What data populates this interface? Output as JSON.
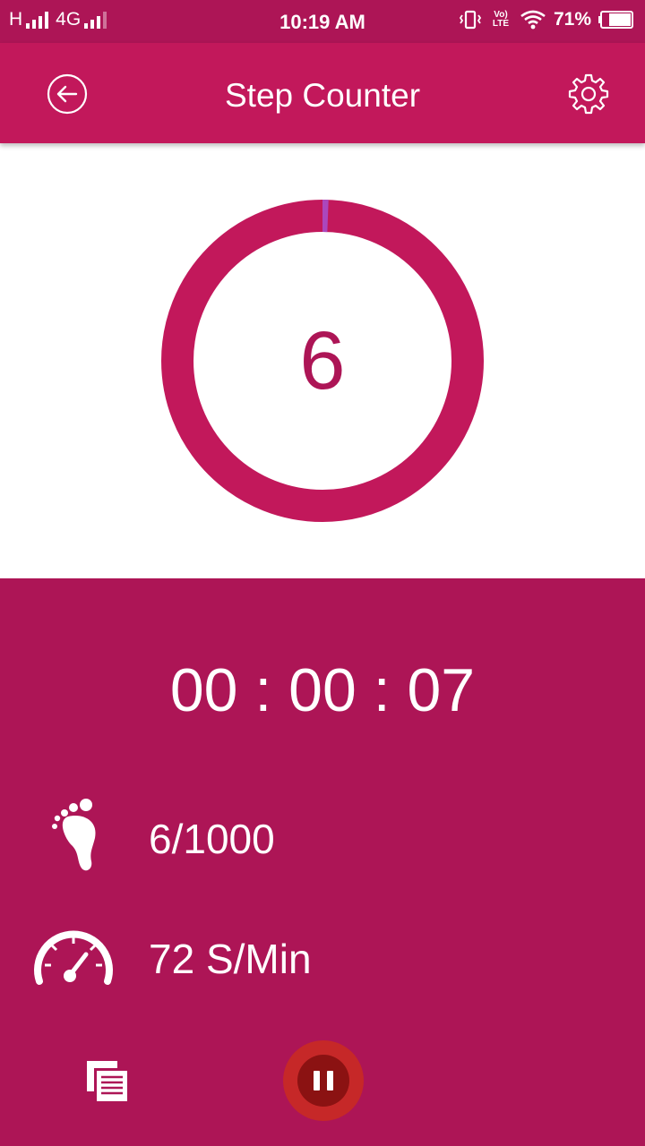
{
  "status_bar": {
    "network_h": "H",
    "network_4g": "4G",
    "time": "10:19 AM",
    "volte": "Vo) LTE",
    "battery": "71%"
  },
  "app_bar": {
    "title": "Step Counter",
    "back_icon": "back-arrow-circle-icon",
    "settings_icon": "gear-icon"
  },
  "progress": {
    "step_count": "6",
    "steps": 6,
    "goal": 1000,
    "track_color": "#c2185b",
    "progress_color": "#ab47bc"
  },
  "stats": {
    "timer": "00 : 00 : 07",
    "steps_goal": "6/1000",
    "pace": "72 S/Min",
    "steps_icon": "footprint-icon",
    "pace_icon": "speedometer-icon"
  },
  "controls": {
    "history_icon": "history-list-icon",
    "pause_icon": "pause-icon"
  },
  "colors": {
    "status_bar": "#ad1556",
    "app_bar": "#c2185b",
    "panel": "#ad1556",
    "pause_outer": "#c62828",
    "pause_inner": "#8b1212"
  }
}
